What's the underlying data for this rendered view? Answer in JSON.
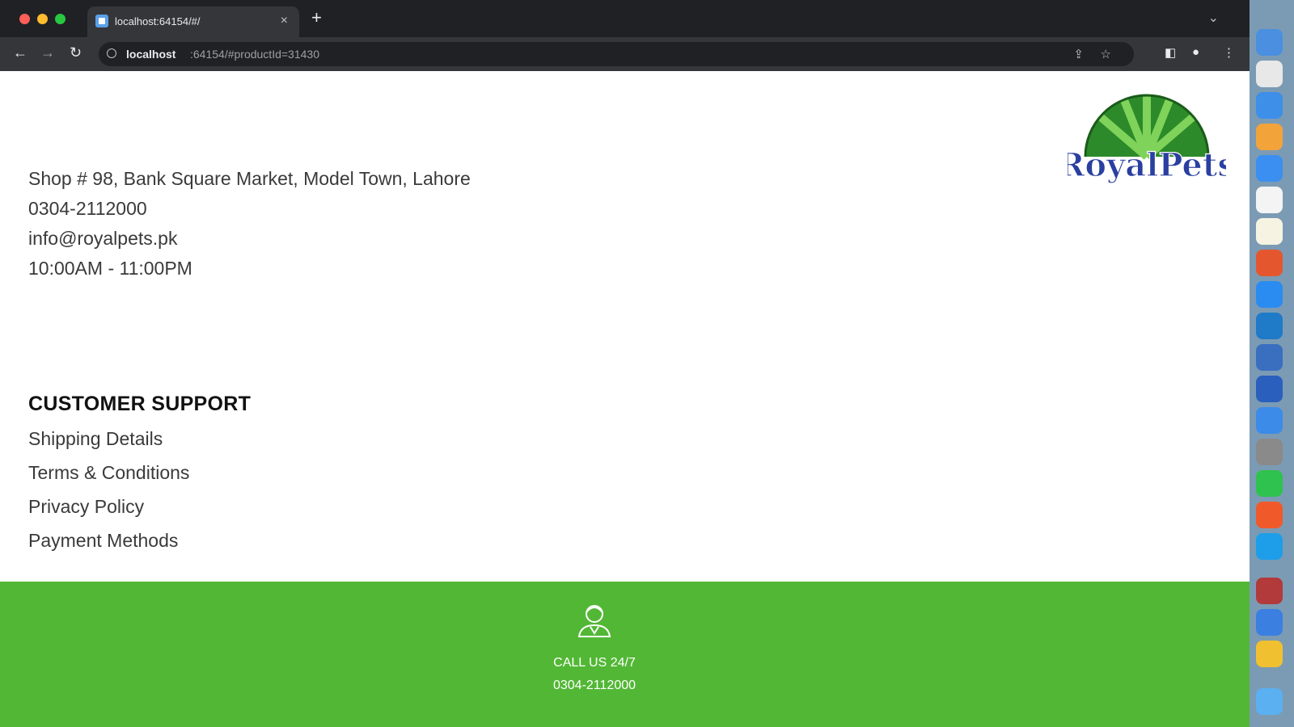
{
  "browser": {
    "tab_title": "localhost:64154/#/",
    "tab_close": "×",
    "new_tab": "+",
    "url_host": "localhost",
    "url_rest": ":64154/#productId=31430"
  },
  "contact": {
    "address": "Shop # 98, Bank Square Market, Model Town, Lahore",
    "phone": "0304-2112000",
    "email": "info@royalpets.pk",
    "hours": "10:00AM - 11:00PM"
  },
  "logo": {
    "text": "RoyalPets"
  },
  "customer_support": {
    "title": "CUSTOMER SUPPORT",
    "links": [
      "Shipping Details",
      "Terms & Conditions",
      "Privacy Policy",
      "Payment Methods"
    ]
  },
  "footer": {
    "call_label": "CALL US 24/7",
    "call_number": "0304-2112000",
    "background": "#52b735"
  },
  "dock": {
    "apps": [
      {
        "icon": "finder-icon",
        "color": "#4a8fe0"
      },
      {
        "icon": "chrome-icon",
        "color": "#e8e8e8"
      },
      {
        "icon": "safari-icon",
        "color": "#3d8fe8"
      },
      {
        "icon": "photos-icon",
        "color": "#f2a33a"
      },
      {
        "icon": "mail-icon",
        "color": "#3b8ff0"
      },
      {
        "icon": "calendar-icon",
        "color": "#f4f4f4"
      },
      {
        "icon": "notes-icon",
        "color": "#f7f3e3"
      },
      {
        "icon": "browser-icon",
        "color": "#e4572e"
      },
      {
        "icon": "app-store-icon",
        "color": "#2a8cf0"
      },
      {
        "icon": "vscode-icon",
        "color": "#1f7ac8"
      },
      {
        "icon": "tool-icon",
        "color": "#3a6fc0"
      },
      {
        "icon": "word-icon",
        "color": "#2b5fbd"
      },
      {
        "icon": "xcode-icon",
        "color": "#3c8be8"
      },
      {
        "icon": "settings-icon",
        "color": "#8a8a8a"
      },
      {
        "icon": "whatsapp-icon",
        "color": "#2fc24f"
      },
      {
        "icon": "swift-icon",
        "color": "#f05a2a"
      },
      {
        "icon": "skype-icon",
        "color": "#1e9ee8"
      },
      {
        "icon": "dictionary-icon",
        "color": "#b23a3a"
      },
      {
        "icon": "flutter-icon",
        "color": "#3b7fe0"
      },
      {
        "icon": "chrome-canary-icon",
        "color": "#f0c030"
      },
      {
        "icon": "folder-icon",
        "color": "#5ab0f0"
      }
    ]
  }
}
